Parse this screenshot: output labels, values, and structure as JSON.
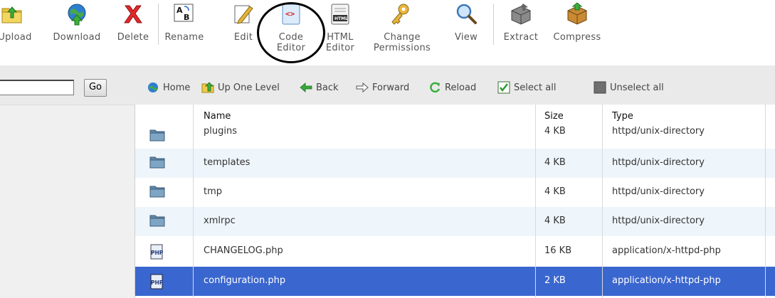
{
  "toolbar": {
    "upload": "Upload",
    "download": "Download",
    "delete": "Delete",
    "rename": "Rename",
    "edit": "Edit",
    "code_editor": "Code\nEditor",
    "html_editor": "HTML\nEditor",
    "change_permissions": "Change\nPermissions",
    "view": "View",
    "extract": "Extract",
    "compress": "Compress"
  },
  "search": {
    "value": "",
    "go_label": "Go"
  },
  "nav": {
    "home": "Home",
    "up_one_level": "Up One Level",
    "back": "Back",
    "forward": "Forward",
    "reload": "Reload",
    "select_all": "Select all",
    "unselect_all": "Unselect all"
  },
  "table": {
    "headers": {
      "name": "Name",
      "size": "Size",
      "type": "Type"
    },
    "rows": [
      {
        "icon": "folder-icon",
        "name": "plugins",
        "size": "4 KB",
        "type": "httpd/unix-directory"
      },
      {
        "icon": "folder-icon",
        "name": "templates",
        "size": "4 KB",
        "type": "httpd/unix-directory"
      },
      {
        "icon": "folder-icon",
        "name": "tmp",
        "size": "4 KB",
        "type": "httpd/unix-directory"
      },
      {
        "icon": "folder-icon",
        "name": "xmlrpc",
        "size": "4 KB",
        "type": "httpd/unix-directory"
      },
      {
        "icon": "php-file-icon",
        "name": "CHANGELOG.php",
        "size": "16 KB",
        "type": "application/x-httpd-php"
      },
      {
        "icon": "php-file-icon",
        "name": "configuration.php",
        "size": "2 KB",
        "type": "application/x-httpd-php",
        "selected": true
      }
    ]
  },
  "colors": {
    "selected_row": "#3a66cf",
    "alt_row": "#eef5fb",
    "nav_band": "#eaeaea",
    "annotation_circle": "#000000"
  }
}
